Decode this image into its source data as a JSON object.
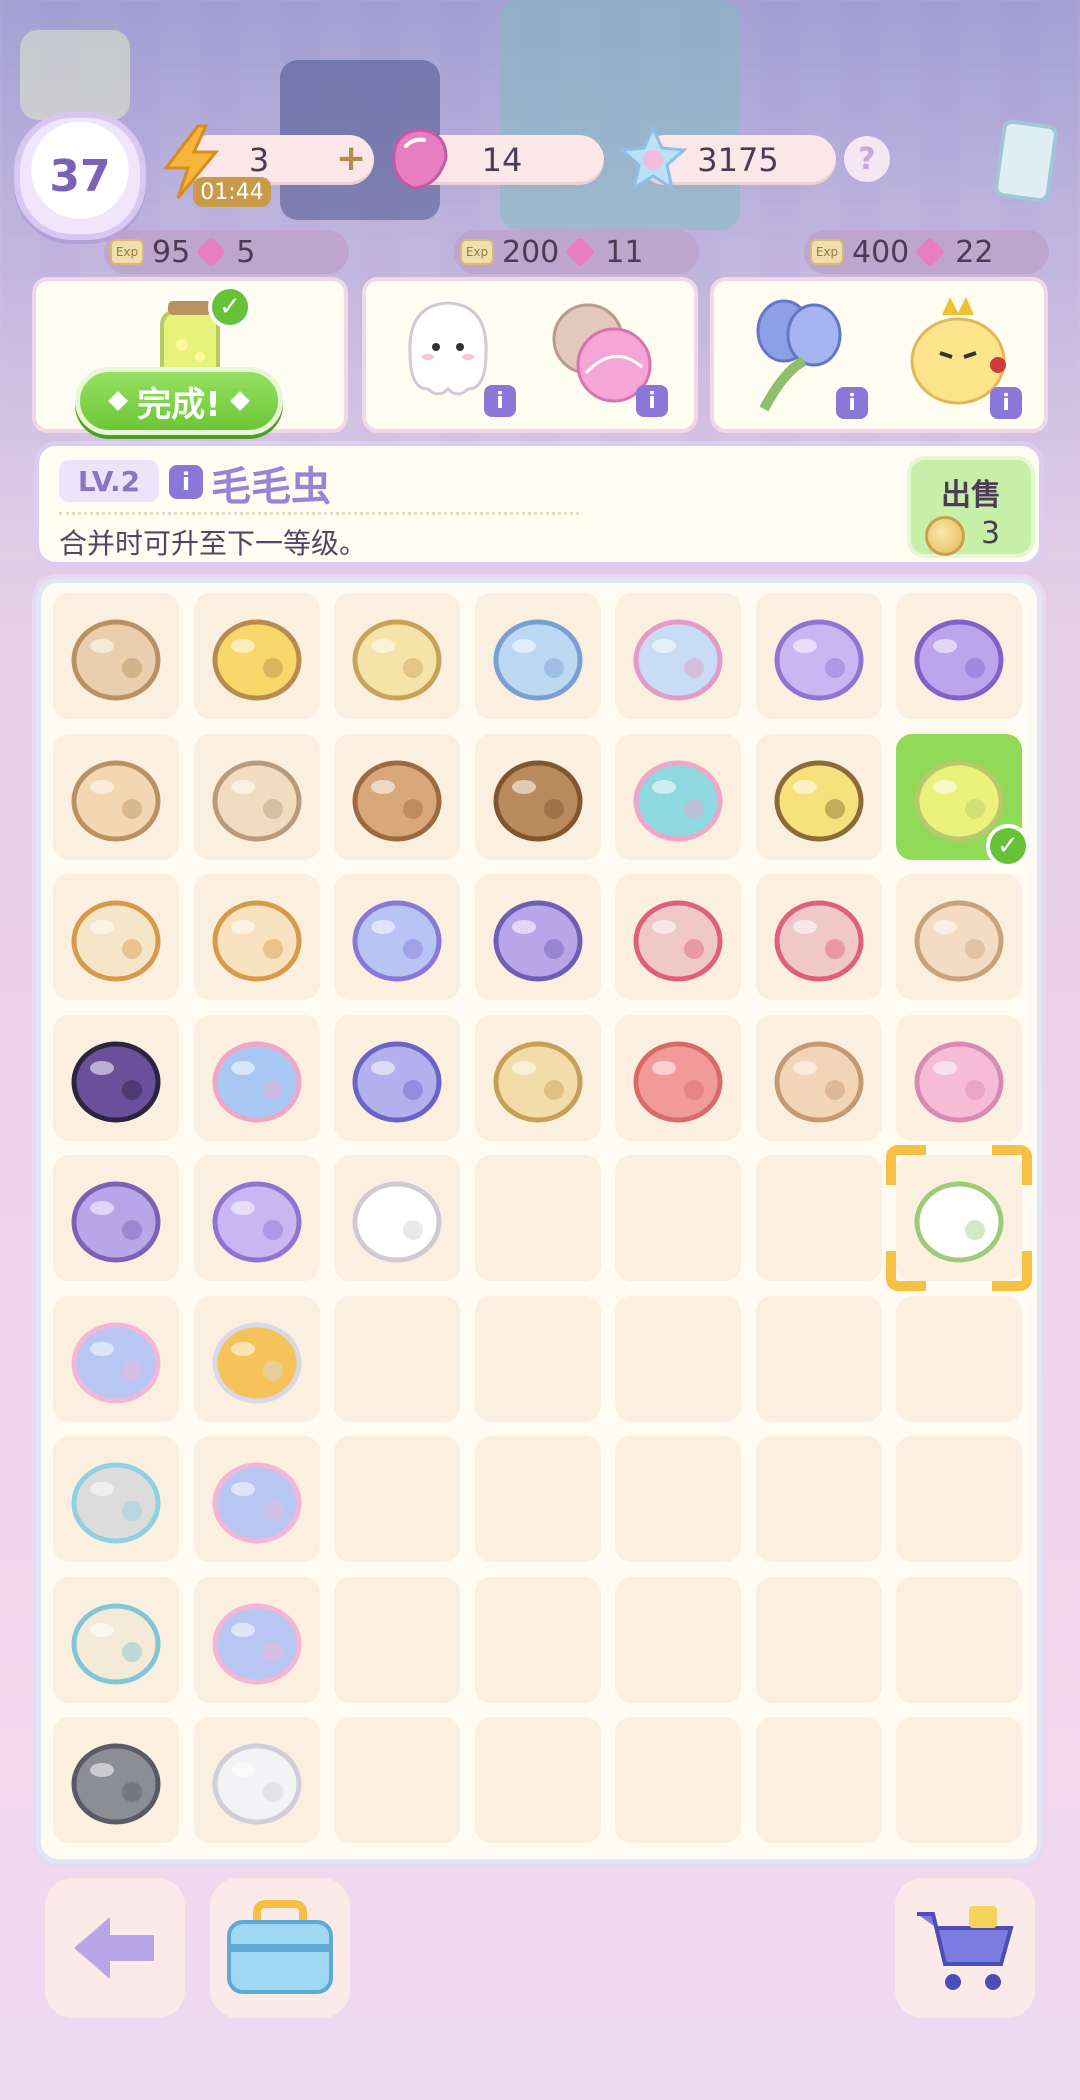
{
  "player": {
    "level": "37"
  },
  "resources": {
    "energy": {
      "value": "3",
      "timer": "01:44",
      "plus": "+"
    },
    "gems": {
      "value": "14"
    },
    "stars": {
      "value": "3175"
    },
    "help": "?"
  },
  "orders": [
    {
      "exp": "95",
      "gems": "5",
      "status_label": "完成!",
      "exp_tag": "Exp"
    },
    {
      "exp": "200",
      "gems": "11",
      "exp_tag": "Exp"
    },
    {
      "exp": "400",
      "gems": "22",
      "exp_tag": "Exp"
    }
  ],
  "selected_item": {
    "level": "LV.2",
    "name": "毛毛虫",
    "description": "合并时可升至下一等级。",
    "sell_label": "出售",
    "sell_price": "3"
  },
  "board_items": [
    [
      "spool-stand-icon",
      "flower-basket-icon",
      "rice-cooker-icon",
      "sewing-machine-icon",
      "sewing-machine-pink-icon",
      "tamagotchi-icon",
      "purple-butterfly-icon"
    ],
    [
      "thread-cart-icon",
      "cocoon-icon",
      "wood-slice-icon",
      "basket-icon",
      "fish-bowl-icon",
      "bees-icon",
      "firefly-jar-icon"
    ],
    [
      "heart-net-icon",
      "flower-net-icon",
      "butterfly-icon",
      "violet-device-icon",
      "fishing-rod-icon",
      "fishing-rod-2-icon",
      "hamster-icon"
    ],
    [
      "cat-guitar-icon",
      "ribbon-bowl-icon",
      "iris-flower-icon",
      "ladybug-icon",
      "coral-icon",
      "hamster-2-icon",
      "hamster-bed-icon"
    ],
    [
      "circuit-board-icon",
      "satellite-dish-icon",
      "ghost-icon",
      "",
      "",
      "",
      "caterpillar-icon"
    ],
    [
      "fabric-roll-icon",
      "scissors-icon",
      "",
      "",
      "",
      "",
      ""
    ],
    [
      "anchor-icon",
      "fabric-rolls-icon",
      "",
      "",
      "",
      "",
      ""
    ],
    [
      "thread-spool-icon",
      "fabric-sheet-icon",
      "",
      "",
      "",
      "",
      ""
    ],
    [
      "hammer-icon",
      "tweezers-icon",
      "",
      "",
      "",
      "",
      ""
    ]
  ],
  "bottom": {
    "back": "back-arrow-icon",
    "toolbox": "toolbox-icon",
    "shop": "shopping-cart-icon"
  }
}
